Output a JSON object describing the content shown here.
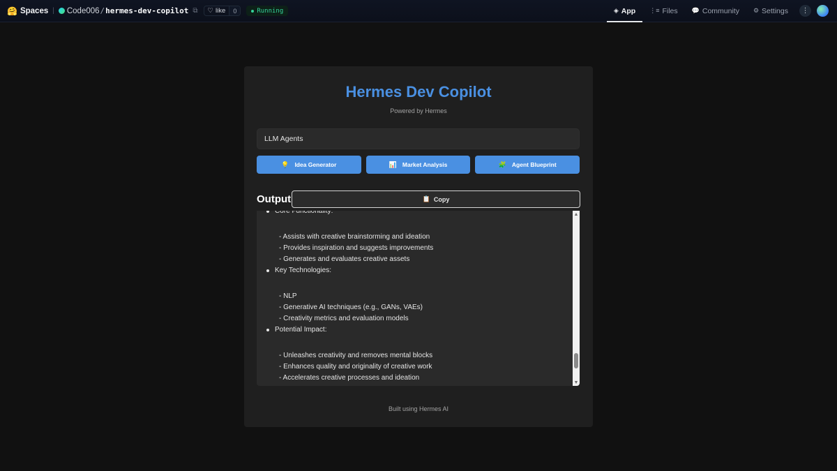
{
  "topbar": {
    "brand_icon": "🤗",
    "brand": "Spaces",
    "owner": "Code006",
    "slash": "/",
    "repo": "hermes-dev-copilot",
    "like_label": "like",
    "like_count": "0",
    "status": "Running",
    "nav": [
      {
        "icon": "cube-icon",
        "glyph": "◈",
        "label": "App",
        "active": true
      },
      {
        "icon": "files-icon",
        "glyph": "⋮≡",
        "label": "Files",
        "active": false
      },
      {
        "icon": "community-icon",
        "glyph": "💬",
        "label": "Community",
        "active": false
      },
      {
        "icon": "gear-icon",
        "glyph": "⚙",
        "label": "Settings",
        "active": false
      }
    ],
    "more_glyph": "⋮"
  },
  "app": {
    "title": "Hermes Dev Copilot",
    "subtitle": "Powered by Hermes",
    "input_value": "LLM Agents",
    "buttons": [
      {
        "icon": "lightbulb-icon",
        "glyph": "💡",
        "label": "Idea Generator"
      },
      {
        "icon": "chart-icon",
        "glyph": "📊",
        "label": "Market Analysis"
      },
      {
        "icon": "puzzle-icon",
        "glyph": "🧩",
        "label": "Agent Blueprint"
      }
    ],
    "output_label": "Output",
    "copy_glyph": "📋",
    "copy_label": "Copy",
    "output": {
      "partial_line": "Core Functionality:",
      "section1": [
        "- Assists with creative brainstorming and ideation",
        "- Provides inspiration and suggests improvements",
        "- Generates and evaluates creative assets"
      ],
      "heading2": "Key Technologies:",
      "section2": [
        "- NLP",
        "- Generative AI techniques (e.g., GANs, VAEs)",
        "- Creativity metrics and evaluation models"
      ],
      "heading3": "Potential Impact:",
      "section3": [
        "- Unleashes creativity and removes mental blocks",
        "- Enhances quality and originality of creative work",
        "- Accelerates creative processes and ideation"
      ]
    },
    "scroll_position": 0.93,
    "footer": "Built using Hermes AI"
  },
  "colors": {
    "accent": "#4a90e2",
    "running": "#34d399"
  }
}
